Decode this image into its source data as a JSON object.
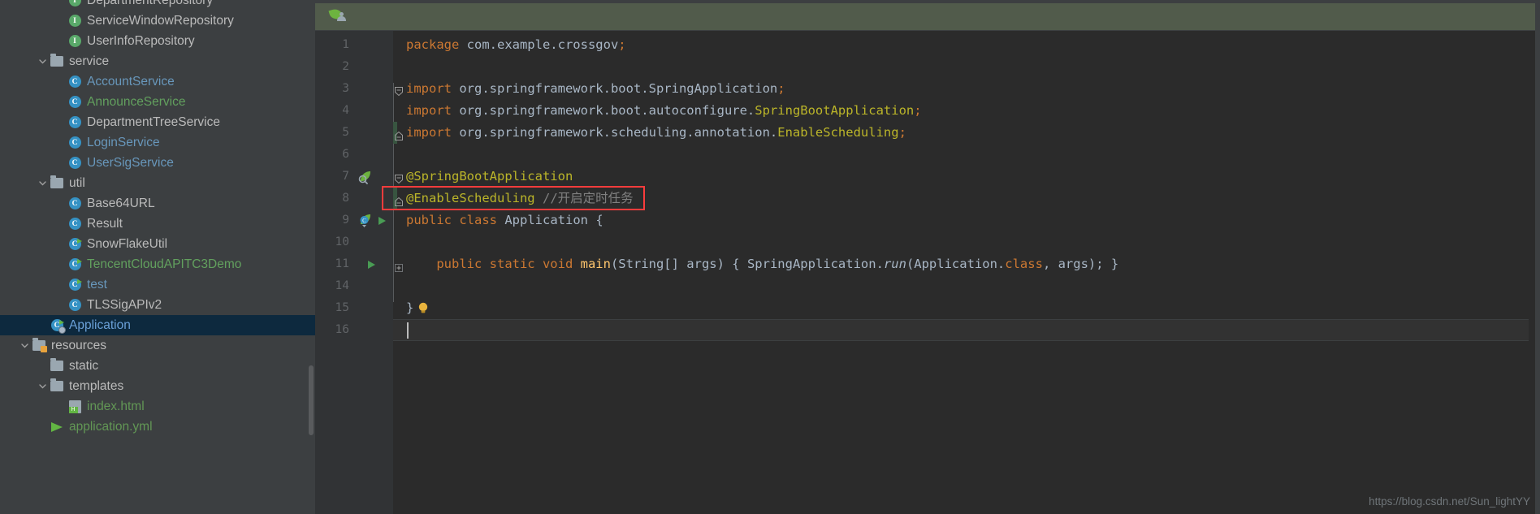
{
  "project_tree": {
    "items": [
      {
        "label": "DepartmentRepository",
        "icon": "interface-icon",
        "indent": 3,
        "color": "default",
        "arrow": "none",
        "clipped": true
      },
      {
        "label": "ServiceWindowRepository",
        "icon": "interface-icon",
        "indent": 3,
        "color": "default",
        "arrow": "none"
      },
      {
        "label": "UserInfoRepository",
        "icon": "interface-icon",
        "indent": 3,
        "color": "default",
        "arrow": "none"
      },
      {
        "label": "service",
        "icon": "folder-icon",
        "indent": 2,
        "color": "default",
        "arrow": "expanded"
      },
      {
        "label": "AccountService",
        "icon": "class-icon",
        "indent": 3,
        "color": "blue",
        "arrow": "none"
      },
      {
        "label": "AnnounceService",
        "icon": "class-icon",
        "indent": 3,
        "color": "green",
        "arrow": "none"
      },
      {
        "label": "DepartmentTreeService",
        "icon": "class-icon",
        "indent": 3,
        "color": "default",
        "arrow": "none"
      },
      {
        "label": "LoginService",
        "icon": "class-icon",
        "indent": 3,
        "color": "blue",
        "arrow": "none"
      },
      {
        "label": "UserSigService",
        "icon": "class-icon",
        "indent": 3,
        "color": "blue",
        "arrow": "none"
      },
      {
        "label": "util",
        "icon": "folder-icon",
        "indent": 2,
        "color": "default",
        "arrow": "expanded"
      },
      {
        "label": "Base64URL",
        "icon": "class-icon",
        "indent": 3,
        "color": "default",
        "arrow": "none"
      },
      {
        "label": "Result",
        "icon": "class-icon",
        "indent": 3,
        "color": "default",
        "arrow": "none"
      },
      {
        "label": "SnowFlakeUtil",
        "icon": "class-runnable-icon",
        "indent": 3,
        "color": "default",
        "arrow": "none"
      },
      {
        "label": "TencentCloudAPITC3Demo",
        "icon": "class-runnable-icon",
        "indent": 3,
        "color": "green",
        "arrow": "none"
      },
      {
        "label": "test",
        "icon": "class-runnable-icon",
        "indent": 3,
        "color": "blue",
        "arrow": "none"
      },
      {
        "label": "TLSSigAPIv2",
        "icon": "class-icon",
        "indent": 3,
        "color": "default",
        "arrow": "none"
      },
      {
        "label": "Application",
        "icon": "spring-class-runnable-icon",
        "indent": 2,
        "color": "selected",
        "arrow": "none",
        "selected": true
      },
      {
        "label": "resources",
        "icon": "resources-folder-icon",
        "indent": 1,
        "color": "default",
        "arrow": "expanded"
      },
      {
        "label": "static",
        "icon": "folder-icon",
        "indent": 2,
        "color": "default",
        "arrow": "none"
      },
      {
        "label": "templates",
        "icon": "folder-icon",
        "indent": 2,
        "color": "default",
        "arrow": "expanded"
      },
      {
        "label": "index.html",
        "icon": "html-file-icon",
        "indent": 3,
        "color": "greenlbl",
        "arrow": "none"
      },
      {
        "label": "application.yml",
        "icon": "yml-file-icon",
        "indent": 2,
        "color": "greenlbl",
        "arrow": "none",
        "clipped": true
      }
    ]
  },
  "editor": {
    "tab_icon": "spring-boot-leaf-icon",
    "line_numbers": [
      "1",
      "2",
      "3",
      "4",
      "5",
      "6",
      "7",
      "8",
      "9",
      "10",
      "11",
      "14",
      "15",
      "16"
    ],
    "lines": [
      {
        "n": "1",
        "tokens": [
          {
            "t": "package ",
            "c": "kw"
          },
          {
            "t": "com.example.crossgov",
            "c": "cls"
          },
          {
            "t": ";",
            "c": "kw"
          }
        ]
      },
      {
        "n": "2",
        "tokens": []
      },
      {
        "n": "3",
        "tokens": [
          {
            "t": "import ",
            "c": "kw"
          },
          {
            "t": "org.springframework.boot.SpringApplication",
            "c": "cls"
          },
          {
            "t": ";",
            "c": "kw"
          }
        ]
      },
      {
        "n": "4",
        "tokens": [
          {
            "t": "import ",
            "c": "kw"
          },
          {
            "t": "org.springframework.boot.autoconfigure.",
            "c": "cls"
          },
          {
            "t": "SpringBootApplication",
            "c": "ann"
          },
          {
            "t": ";",
            "c": "kw"
          }
        ]
      },
      {
        "n": "5",
        "tokens": [
          {
            "t": "import ",
            "c": "kw"
          },
          {
            "t": "org.springframework.scheduling.annotation.",
            "c": "cls"
          },
          {
            "t": "EnableScheduling",
            "c": "ann"
          },
          {
            "t": ";",
            "c": "kw"
          }
        ]
      },
      {
        "n": "6",
        "tokens": []
      },
      {
        "n": "7",
        "tokens": [
          {
            "t": "@SpringBootApplication",
            "c": "ann"
          }
        ]
      },
      {
        "n": "8",
        "tokens": [
          {
            "t": "@EnableScheduling ",
            "c": "ann"
          },
          {
            "t": "//开启定时任务",
            "c": "cmt"
          }
        ]
      },
      {
        "n": "9",
        "tokens": [
          {
            "t": "public class ",
            "c": "kw"
          },
          {
            "t": "Application ",
            "c": "cls"
          },
          {
            "t": "{",
            "c": "cls"
          }
        ]
      },
      {
        "n": "10",
        "tokens": []
      },
      {
        "n": "11",
        "tokens": [
          {
            "t": "    public static void ",
            "c": "kw"
          },
          {
            "t": "main",
            "c": "fn"
          },
          {
            "t": "(String[] args) ",
            "c": "cls"
          },
          {
            "t": "{ ",
            "c": "cls"
          },
          {
            "t": "SpringApplication.",
            "c": "cls"
          },
          {
            "t": "run",
            "c": "ital"
          },
          {
            "t": "(Application.",
            "c": "cls"
          },
          {
            "t": "class",
            "c": "kw"
          },
          {
            "t": ", args); }",
            "c": "cls"
          }
        ]
      },
      {
        "n": "14",
        "tokens": []
      },
      {
        "n": "15",
        "tokens": [
          {
            "t": "}",
            "c": "cls"
          }
        ]
      },
      {
        "n": "16",
        "tokens": []
      }
    ],
    "gutter_icons": [
      {
        "line": "7",
        "icon": "spring-bean-gutter-icon"
      },
      {
        "line": "9",
        "icon": "spring-class-gutter-icon"
      },
      {
        "line": "9",
        "icon": "run-gutter-icon"
      },
      {
        "line": "11",
        "icon": "run-gutter-icon"
      }
    ],
    "annotation_box": {
      "color": "#fa3c3c",
      "target_line": "8"
    },
    "intention_bulb": {
      "line": "15",
      "icon": "lightbulb-icon"
    },
    "caret_line": "16"
  },
  "watermark": {
    "text": "https://blog.csdn.net/Sun_lightYY"
  },
  "colors": {
    "sidebar_bg": "#3c3f41",
    "editor_bg": "#2b2b2b",
    "gutter_bg": "#313335",
    "tab_bg": "#515b4b",
    "selection_bg": "#0d293e",
    "annotation_red": "#fa3c3c",
    "annotation_yellow": "#bbb529",
    "keyword_orange": "#cc7832",
    "class_blue": "#3592c4",
    "interface_green": "#59a869",
    "run_green": "#62b543"
  }
}
